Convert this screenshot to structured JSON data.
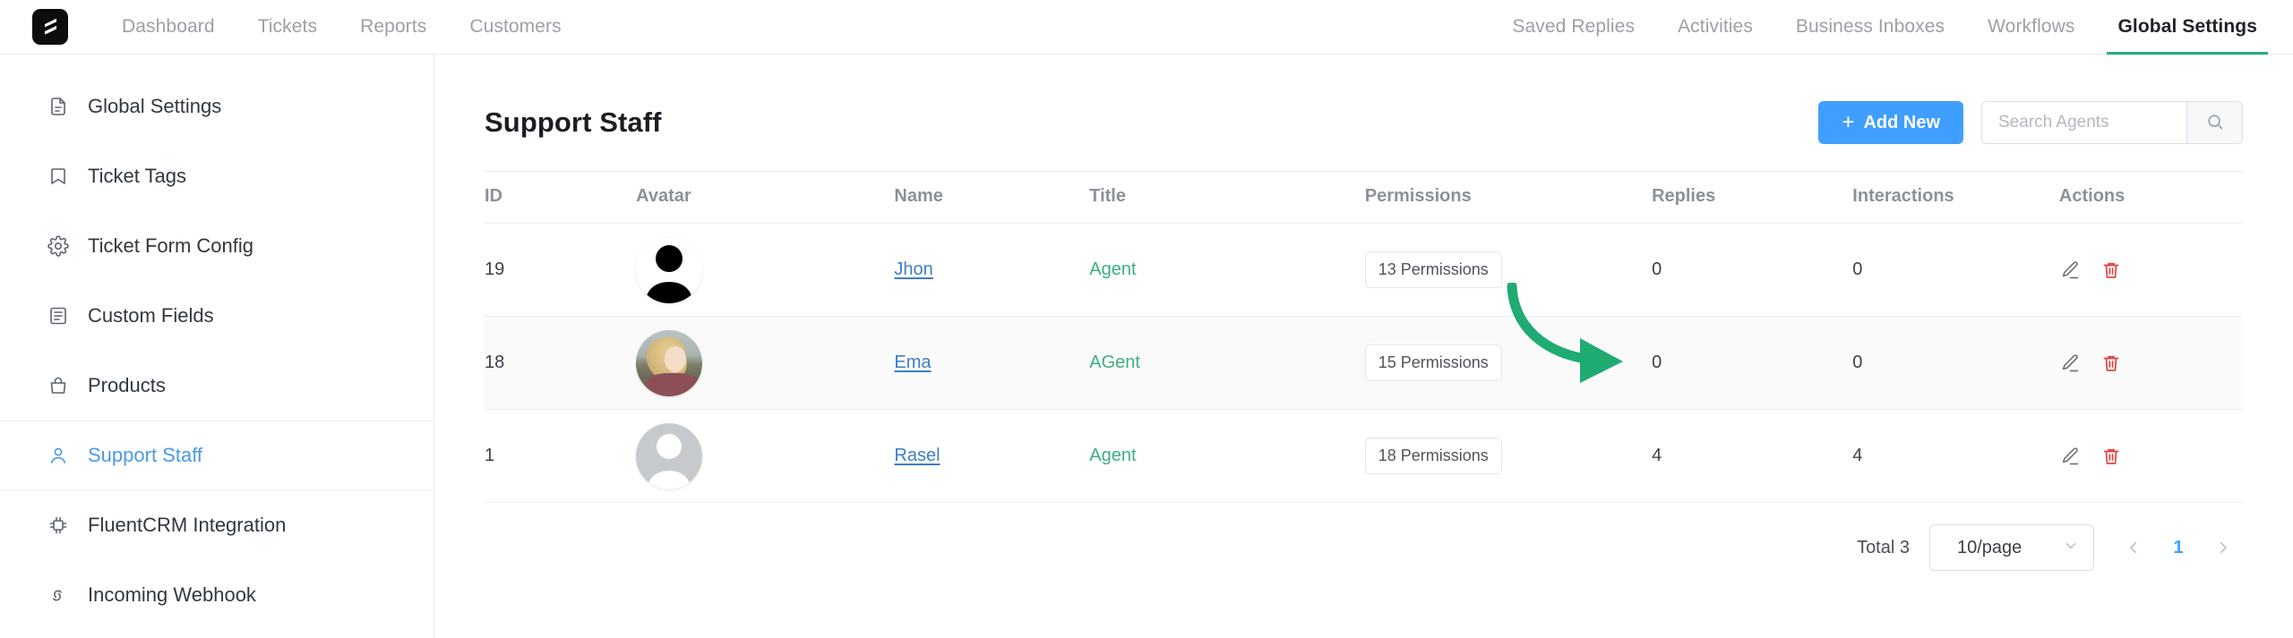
{
  "app": {
    "logo_icon": "fluent-support-logo"
  },
  "topnav": {
    "left_items": [
      {
        "label": "Dashboard",
        "active": false
      },
      {
        "label": "Tickets",
        "active": false
      },
      {
        "label": "Reports",
        "active": false
      },
      {
        "label": "Customers",
        "active": false
      }
    ],
    "right_items": [
      {
        "label": "Saved Replies",
        "active": false
      },
      {
        "label": "Activities",
        "active": false
      },
      {
        "label": "Business Inboxes",
        "active": false
      },
      {
        "label": "Workflows",
        "active": false
      },
      {
        "label": "Global Settings",
        "active": true
      }
    ],
    "active_underline_color": "#27ab83"
  },
  "sidebar": {
    "items": [
      {
        "label": "Global Settings",
        "icon": "document-icon",
        "active": false
      },
      {
        "label": "Ticket Tags",
        "icon": "bookmark-icon",
        "active": false
      },
      {
        "label": "Ticket Form Config",
        "icon": "gear-icon",
        "active": false
      },
      {
        "label": "Custom Fields",
        "icon": "list-box-icon",
        "active": false
      },
      {
        "label": "Products",
        "icon": "bag-icon",
        "active": false
      },
      {
        "label": "Support Staff",
        "icon": "user-icon",
        "active": true
      },
      {
        "label": "FluentCRM Integration",
        "icon": "chip-icon",
        "active": false
      },
      {
        "label": "Incoming Webhook",
        "icon": "webhook-icon",
        "active": false
      }
    ],
    "active_color": "#4a9ae8"
  },
  "main": {
    "page_title": "Support Staff",
    "add_button": {
      "label": "Add New",
      "icon": "plus-icon",
      "color": "#409eff"
    },
    "search": {
      "placeholder": "Search Agents",
      "value": "",
      "icon": "search-icon"
    },
    "table": {
      "columns": [
        "ID",
        "Avatar",
        "Name",
        "Title",
        "Permissions",
        "Replies",
        "Interactions",
        "Actions"
      ],
      "rows": [
        {
          "id": "19",
          "avatar": "black-silhouette-avatar",
          "name": "Jhon",
          "title": "Agent",
          "permissions": "13 Permissions",
          "replies": "0",
          "interactions": "0",
          "actions": [
            "edit-icon",
            "delete-icon"
          ]
        },
        {
          "id": "18",
          "avatar": "photo-avatar-blonde-woman",
          "name": "Ema",
          "title": "AGent",
          "permissions": "15 Permissions",
          "replies": "0",
          "interactions": "0",
          "actions": [
            "edit-icon",
            "delete-icon"
          ]
        },
        {
          "id": "1",
          "avatar": "gray-placeholder-avatar",
          "name": "Rasel",
          "title": "Agent",
          "permissions": "18 Permissions",
          "replies": "4",
          "interactions": "4",
          "actions": [
            "edit-icon",
            "delete-icon"
          ]
        }
      ]
    },
    "footer": {
      "total_label": "Total 3",
      "page_size": "10/page",
      "prev_icon": "chevron-left-icon",
      "next_icon": "chevron-right-icon",
      "current_page": "1"
    },
    "annotation": {
      "type": "curved-arrow",
      "color": "#1fab72",
      "points_to": "edit-icon-row-3"
    },
    "title_color": "#3fae7d",
    "name_link_color": "#3d7fc7",
    "delete_icon_color": "#e0443e"
  }
}
